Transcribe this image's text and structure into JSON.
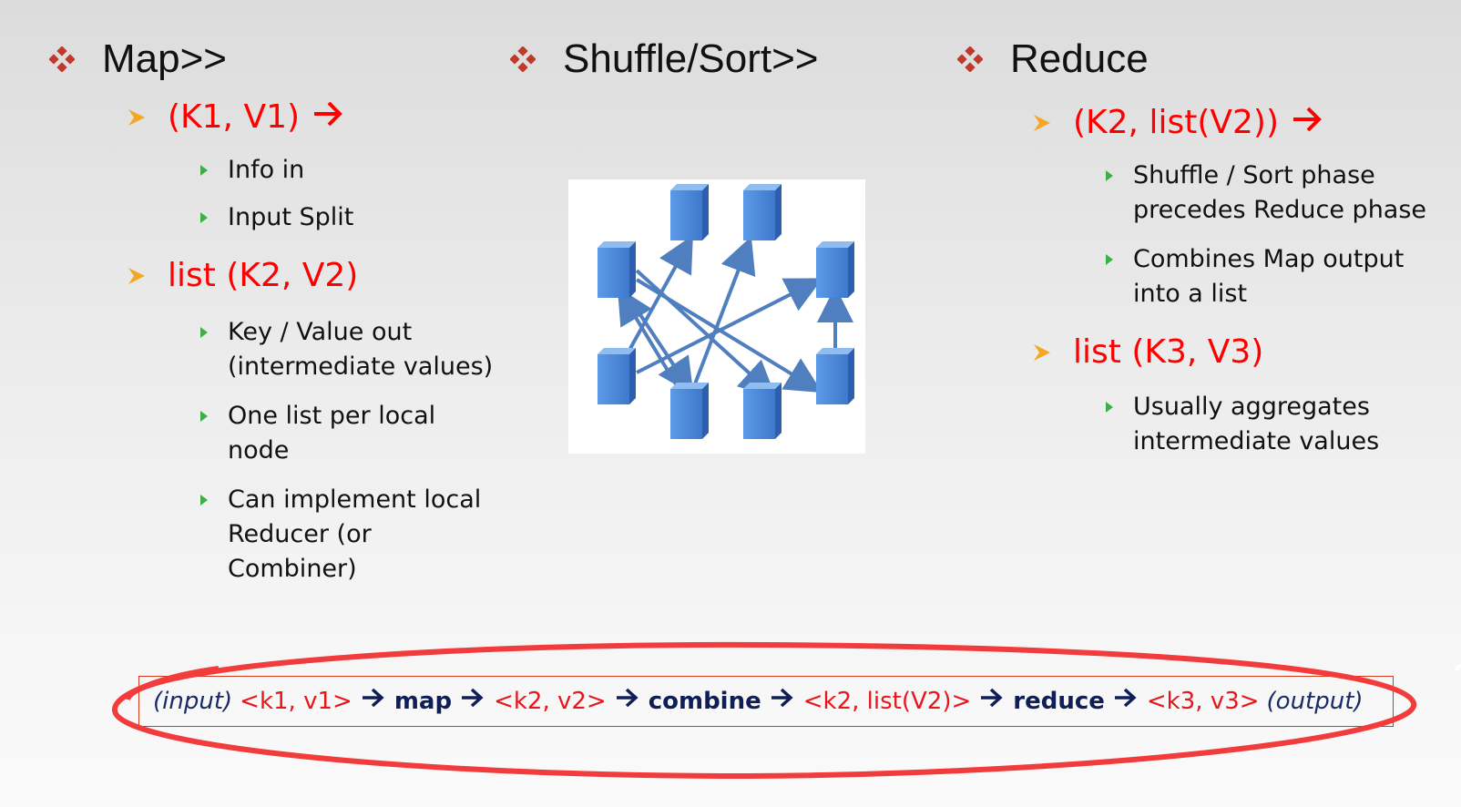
{
  "columns": {
    "map": {
      "heading": "Map>>",
      "items": [
        {
          "label": "(K1, V1)",
          "arrow": true,
          "bullets": [
            "Info in",
            "Input Split"
          ]
        },
        {
          "label": "list (K2, V2)",
          "arrow": false,
          "bullets": [
            "Key / Value out\n(intermediate values)",
            "One list per local\nnode",
            "Can implement local\nReducer (or\nCombiner)"
          ]
        }
      ]
    },
    "shuffle": {
      "heading": "Shuffle/Sort>>"
    },
    "reduce": {
      "heading": "Reduce",
      "items": [
        {
          "label": "(K2, list(V2))",
          "arrow": true,
          "bullets": [
            "Shuffle / Sort phase\nprecedes Reduce phase",
            "Combines Map output\ninto a list"
          ]
        },
        {
          "label": "list (K3, V3)",
          "arrow": false,
          "bullets": [
            "Usually aggregates\nintermediate values"
          ]
        }
      ]
    }
  },
  "flow": {
    "input": "(input)",
    "kv1": "<k1, v1>",
    "op_map": "map",
    "kv2": "<k2, v2>",
    "op_combine": "combine",
    "kv3": "<k2, list(V2)>",
    "op_reduce": "reduce",
    "kv4": "<k3, v3>",
    "output": "(output)"
  },
  "colors": {
    "diamond": "#c0392b",
    "chevron": "#f5a623",
    "triangle": "#3cb043",
    "highlight": "#ff0000",
    "node": "#4a86d8",
    "ellipse": "#f23b3b"
  },
  "icons": {
    "heading_bullet": "diamond-cluster-icon",
    "level1_bullet": "chevron-right-icon",
    "level2_bullet": "triangle-right-icon",
    "flow_arrow": "arrow-right-icon",
    "diagram": "network-nodes-illustration"
  }
}
